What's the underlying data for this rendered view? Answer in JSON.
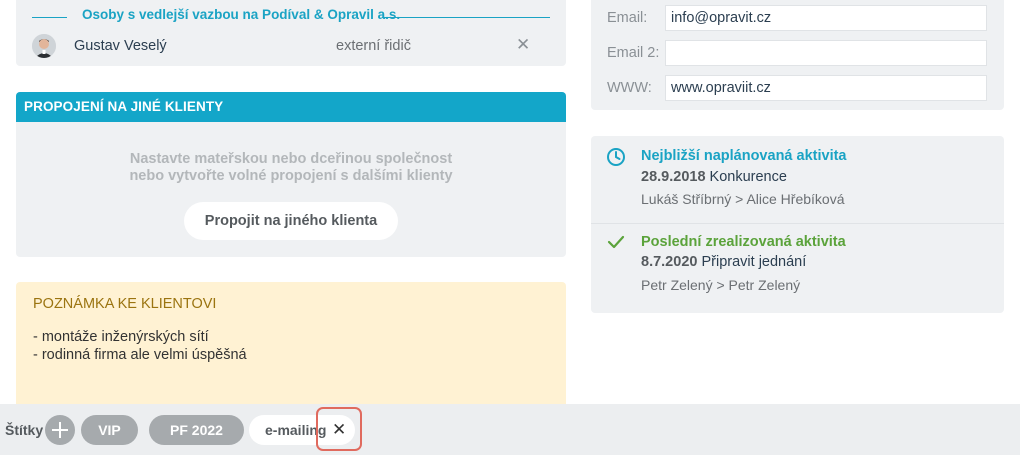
{
  "related": {
    "title": "Osoby s vedlejší vazbou na Podíval & Opravil a.s.",
    "person": {
      "name": "Gustav Veselý",
      "role": "externí řidič"
    },
    "remove_symbol": "✕"
  },
  "connections": {
    "header": "PROPOJENÍ NA JINÉ KLIENTY",
    "hint_line1": "Nastavte mateřskou nebo dceřinou společnost",
    "hint_line2": "nebo vytvořte volné propojení s dalšími klienty",
    "button": "Propojit na jiného klienta"
  },
  "note": {
    "title": "POZNÁMKA KE KLIENTOVI",
    "lines": [
      "- montáže inženýrských sítí",
      "- rodinná firma ale velmi úspěšná"
    ]
  },
  "contact": {
    "email_label": "Email:",
    "email_value": "info@opravit.cz",
    "email2_label": "Email 2:",
    "email2_value": "",
    "www_label": "WWW:",
    "www_value": "www.opraviit.cz"
  },
  "activities": {
    "next": {
      "title": "Nejbližší naplánovaná aktivita",
      "date": "28.9.2018",
      "name": "Konkurence",
      "people": "Lukáš Stříbrný > Alice Hřebíková"
    },
    "last": {
      "title": "Poslední zrealizovaná aktivita",
      "date": "8.7.2020",
      "name": "Připravit jednání",
      "people": "Petr Zelený > Petr Zelený"
    }
  },
  "tags": {
    "label": "Štítky",
    "items": [
      "VIP",
      "PF 2022",
      "e-mailing"
    ],
    "remove_symbol": "✕"
  },
  "colors": {
    "accent": "#13a6c9",
    "success": "#5ba33b",
    "note_bg": "#fff2d3",
    "highlight": "#e06a5e"
  },
  "icons": [
    "avatar",
    "close-icon",
    "clock-icon",
    "check-icon",
    "plus-icon"
  ]
}
